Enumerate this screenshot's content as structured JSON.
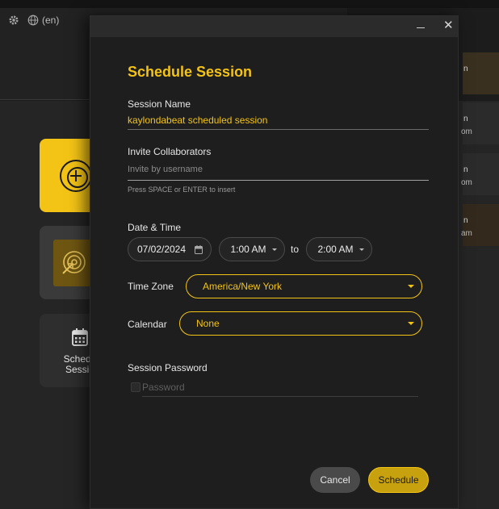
{
  "app": {
    "language_label": "(en)",
    "icons": {
      "settings": "gear-icon",
      "language": "globe-icon"
    }
  },
  "background": {
    "tiles": [
      {
        "name": "create",
        "icon": "plus-circle-icon",
        "color": "#f3c316"
      },
      {
        "name": "join",
        "icon": "radar-icon",
        "color": "#6e5612"
      },
      {
        "name": "schedule",
        "icon": "calendar-icon",
        "label_line1": "Schedu",
        "label_line2": "Sessio"
      }
    ],
    "side_cards": [
      {
        "a": "n",
        "b": ""
      },
      {
        "a": "n",
        "b": "om"
      },
      {
        "a": "n",
        "b": "om"
      },
      {
        "a": "n",
        "b": "am"
      }
    ]
  },
  "modal": {
    "title": "Schedule Session",
    "controls": {
      "minimize": "minimize-icon",
      "close": "✕"
    },
    "session_name": {
      "label": "Session Name",
      "value": "kaylondabeat scheduled session"
    },
    "invite": {
      "label": "Invite Collaborators",
      "placeholder": "Invite by username",
      "hint": "Press SPACE or ENTER to insert"
    },
    "datetime": {
      "label": "Date & Time",
      "date": "07/02/2024",
      "start": "1:00 AM",
      "to": "to",
      "end": "2:00 AM"
    },
    "timezone": {
      "label": "Time Zone",
      "value": "America/New York"
    },
    "calendar": {
      "label": "Calendar",
      "value": "None"
    },
    "password": {
      "label": "Session Password",
      "placeholder": "Password",
      "checked": false
    },
    "buttons": {
      "cancel": "Cancel",
      "schedule": "Schedule"
    },
    "colors": {
      "accent": "#f3c316",
      "background": "#1e1e1e"
    }
  }
}
